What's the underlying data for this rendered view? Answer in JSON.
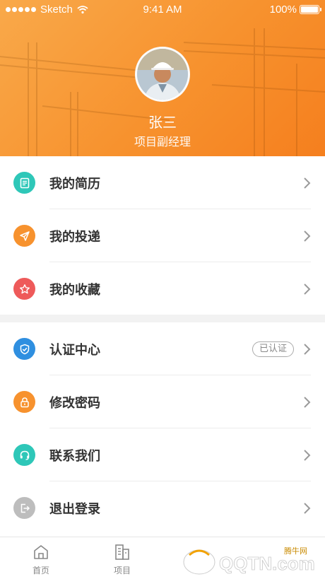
{
  "status_bar": {
    "carrier": "Sketch",
    "time": "9:41 AM",
    "battery": "100%",
    "battery_level": 1.0
  },
  "profile": {
    "name": "张三",
    "role": "项目副经理"
  },
  "menu_group_1": [
    {
      "label": "我的简历",
      "icon": "resume-icon",
      "color": "#2ec7b8"
    },
    {
      "label": "我的投递",
      "icon": "paper-plane-icon",
      "color": "#f7922e"
    },
    {
      "label": "我的收藏",
      "icon": "star-icon",
      "color": "#ee5a5a"
    }
  ],
  "menu_group_2": [
    {
      "label": "认证中心",
      "icon": "shield-icon",
      "color": "#2f8fe0",
      "badge": "已认证"
    },
    {
      "label": "修改密码",
      "icon": "lock-icon",
      "color": "#f7922e"
    },
    {
      "label": "联系我们",
      "icon": "headset-icon",
      "color": "#2ec7b8"
    },
    {
      "label": "退出登录",
      "icon": "logout-icon",
      "color": "#bdbdbd"
    }
  ],
  "tabs": [
    {
      "label": "首页",
      "icon": "home-icon"
    },
    {
      "label": "项目",
      "icon": "building-icon"
    }
  ],
  "watermark": {
    "text": "QQTN.com",
    "subtext": "腾牛网"
  }
}
